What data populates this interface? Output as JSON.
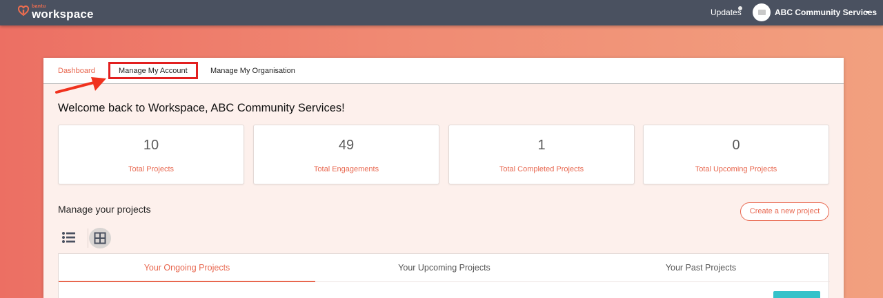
{
  "header": {
    "logo_small": "bantu",
    "logo_main": "workspace",
    "updates_label": "Updates",
    "org_name": "ABC Community Services"
  },
  "nav": {
    "tabs": [
      {
        "label": "Dashboard",
        "active": true
      },
      {
        "label": "Manage My Account",
        "highlighted": true
      },
      {
        "label": "Manage My Organisation"
      }
    ]
  },
  "main": {
    "welcome": "Welcome back to Workspace, ABC Community Services!",
    "stats": [
      {
        "value": "10",
        "label": "Total Projects"
      },
      {
        "value": "49",
        "label": "Total Engagements"
      },
      {
        "value": "1",
        "label": "Total Completed Projects"
      },
      {
        "value": "0",
        "label": "Total Upcoming Projects"
      }
    ],
    "manage_title": "Manage your projects",
    "create_button": "Create a new project",
    "project_tabs": [
      {
        "label": "Your Ongoing Projects",
        "active": true
      },
      {
        "label": "Your Upcoming Projects"
      },
      {
        "label": "Your Past Projects"
      }
    ]
  },
  "icons": {
    "logo": "bantu-logo-icon",
    "avatar": "avatar-image-icon",
    "dropdown": "caret-down-icon",
    "annotation": "red-arrow-icon",
    "list_view": "list-view-icon",
    "grid_view": "grid-view-icon"
  },
  "colors": {
    "accent": "#e8674f",
    "topbar": "#4a5160",
    "highlight": "#e21f1f",
    "teal": "#35c2c9"
  }
}
